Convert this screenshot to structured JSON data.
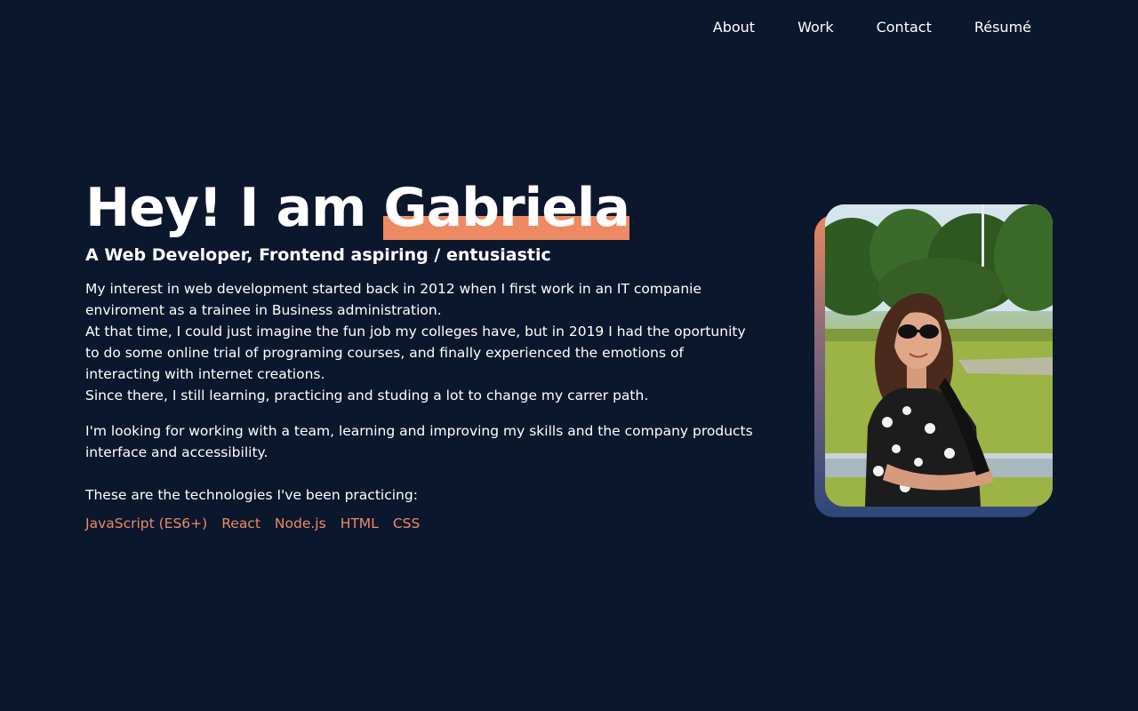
{
  "nav": {
    "items": [
      "About",
      "Work",
      "Contact",
      "Résumé"
    ]
  },
  "hero": {
    "greeting": "Hey! I am ",
    "name": "Gabriela",
    "subtitle": "A Web Developer, Frontend aspiring / entusiastic",
    "bio_lines": [
      "My interest in web development started back in 2012 when I first work in an IT companie enviroment as a trainee in Business administration.",
      "At that time, I could just imagine the fun job my colleges have, but in 2019 I had the oportunity to do some online trial of programing courses, and finally experienced the emotions of interacting with internet creations.",
      "Since there, I still learning, practicing and studing a lot to change my carrer path."
    ],
    "bio_paragraph2": "I'm looking for working with a team, learning and improving my skills and the company products interface and accessibility.",
    "tech_intro": "These are the technologies I've been practicing:",
    "technologies": [
      "JavaScript (ES6+)",
      "React",
      "Node.js",
      "HTML",
      "CSS"
    ]
  },
  "colors": {
    "background": "#0b172d",
    "accent": "#ee8a62",
    "text": "#ffffff",
    "frame_bottom": "#2e4679"
  }
}
